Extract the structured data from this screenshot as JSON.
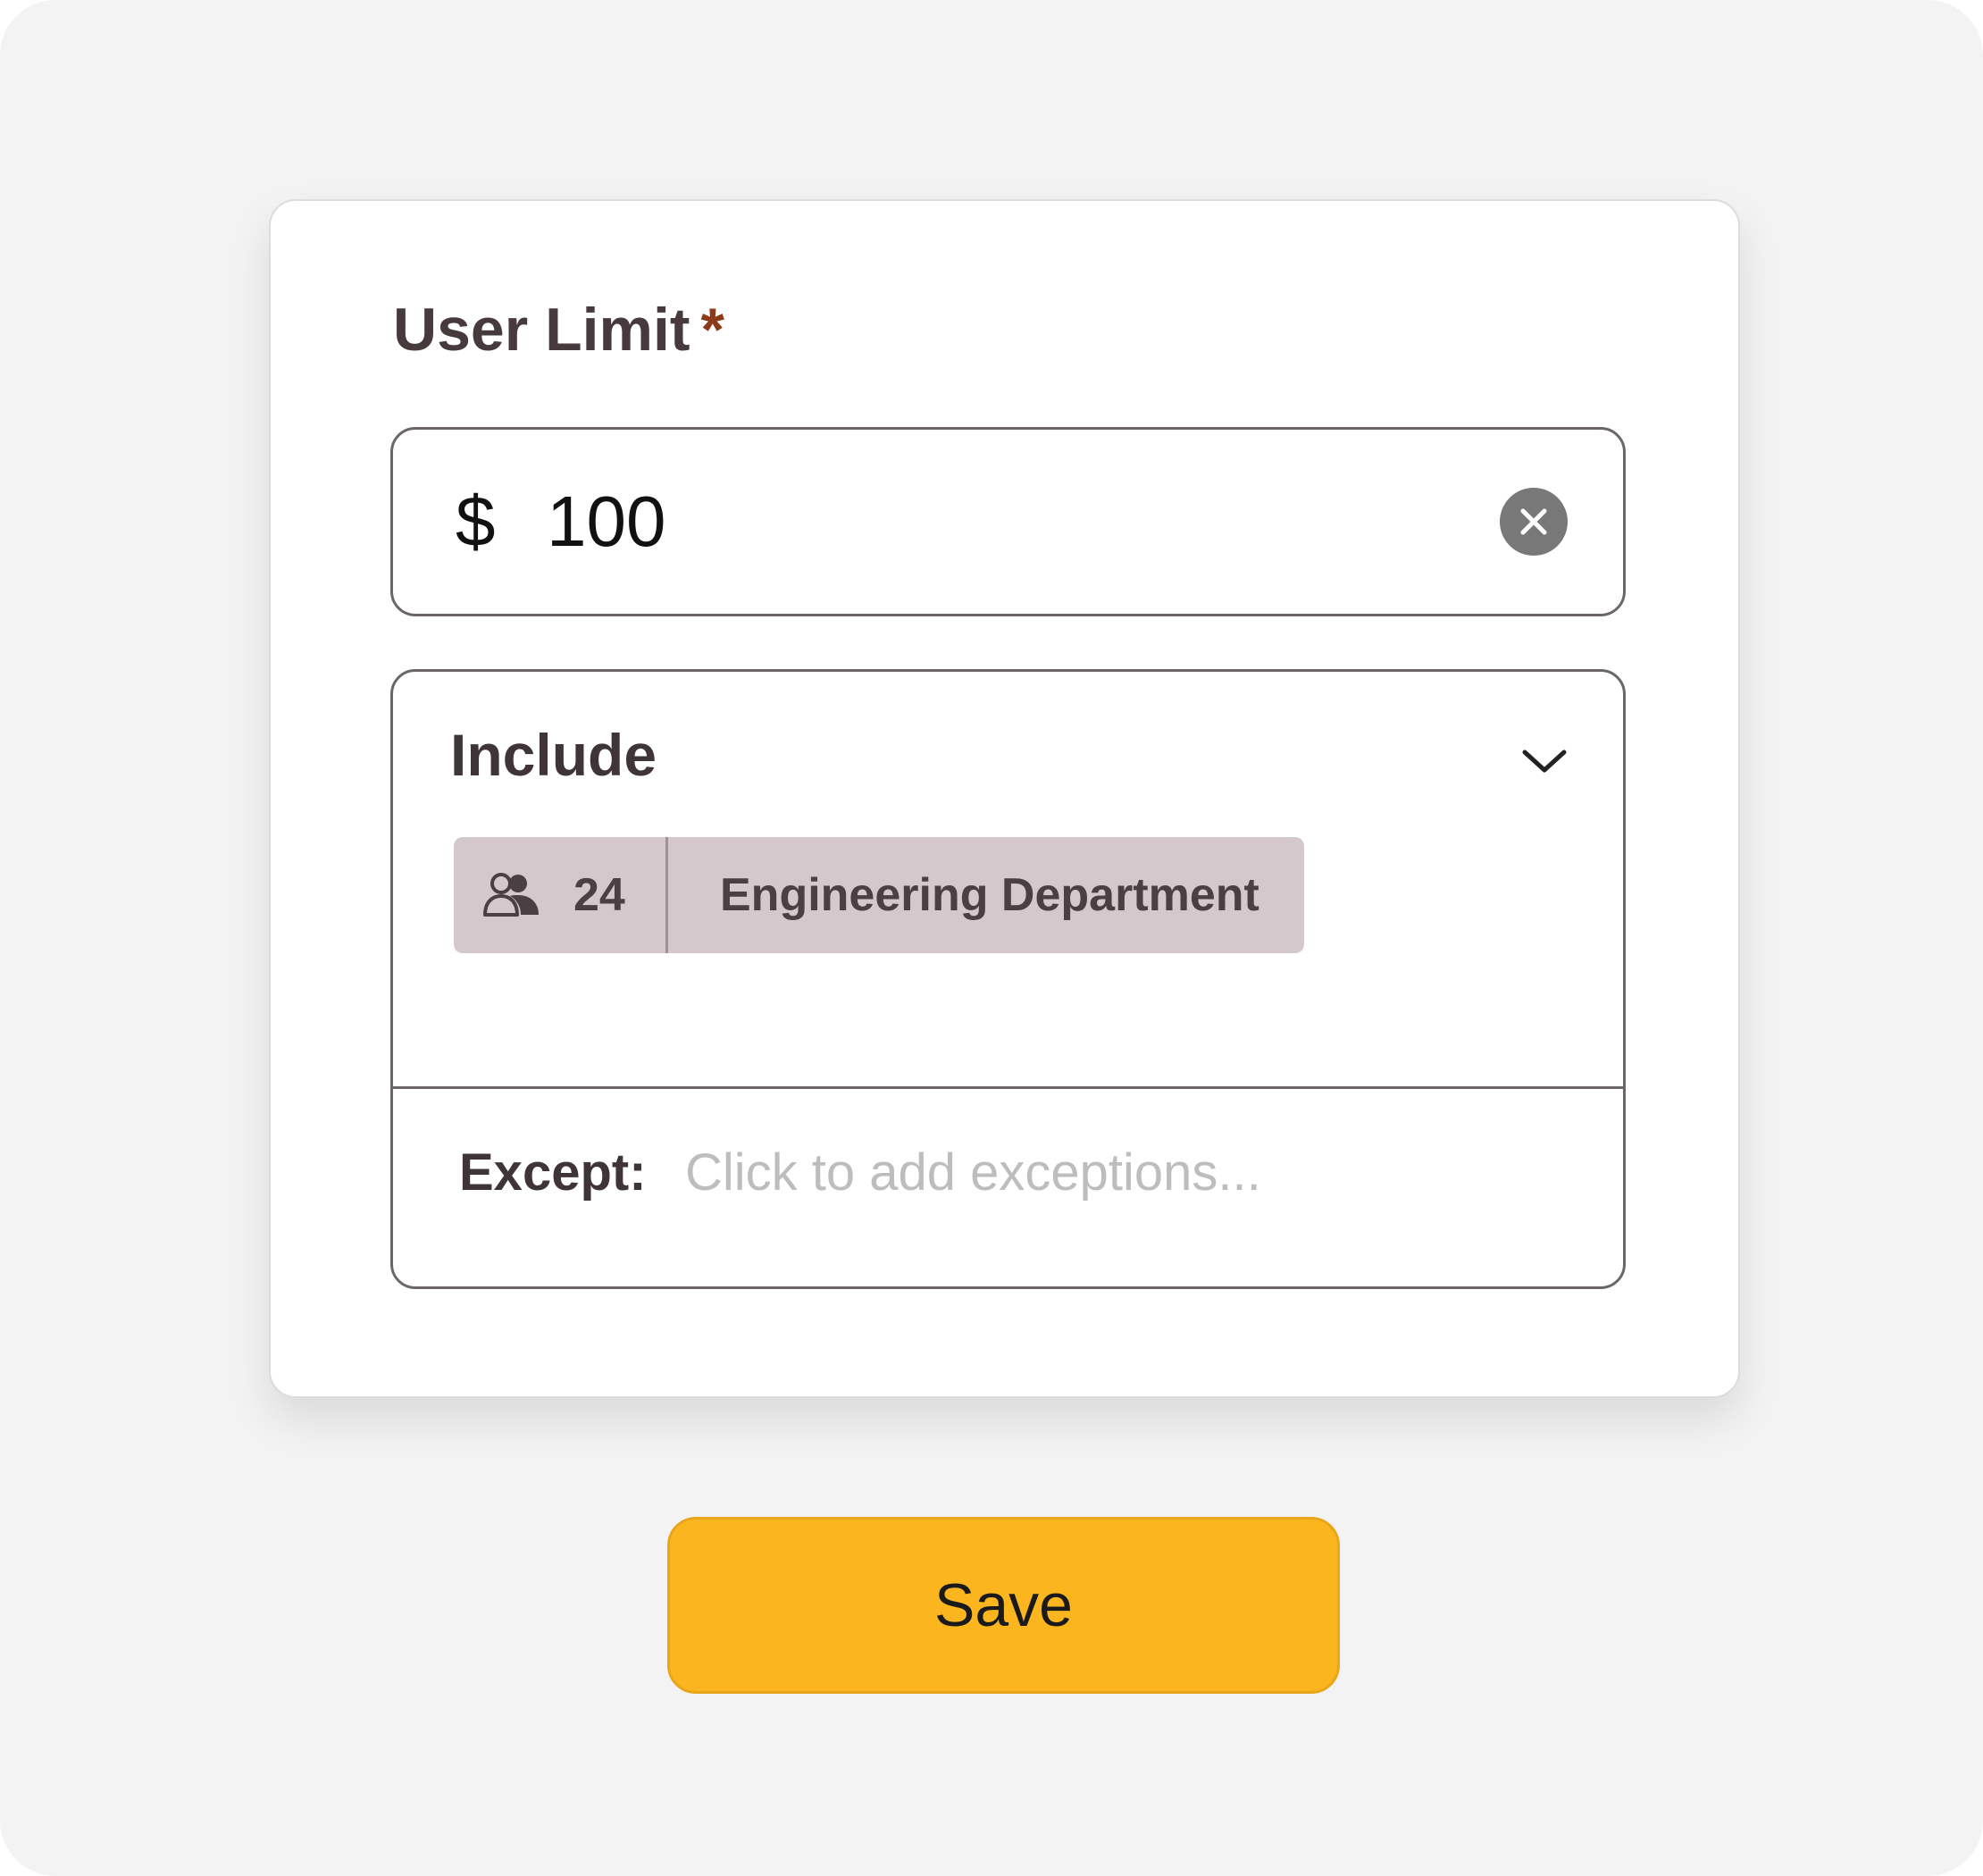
{
  "form": {
    "field_label": "User Limit",
    "required_mark": "*",
    "amount": {
      "currency_symbol": "$",
      "value": "100",
      "clear_icon": "close-circle-icon"
    },
    "include": {
      "label": "Include",
      "dropdown_icon": "chevron-down-icon",
      "chips": [
        {
          "icon": "users-icon",
          "count": "24",
          "name": "Engineering Department"
        }
      ]
    },
    "except": {
      "label": "Except:",
      "placeholder": "Click to add exceptions..."
    }
  },
  "actions": {
    "save_label": "Save"
  },
  "colors": {
    "accent": "#fbb61f",
    "required": "#8b3a1a",
    "chip_background": "#d4c8cc",
    "background": "#f3f3f3"
  }
}
